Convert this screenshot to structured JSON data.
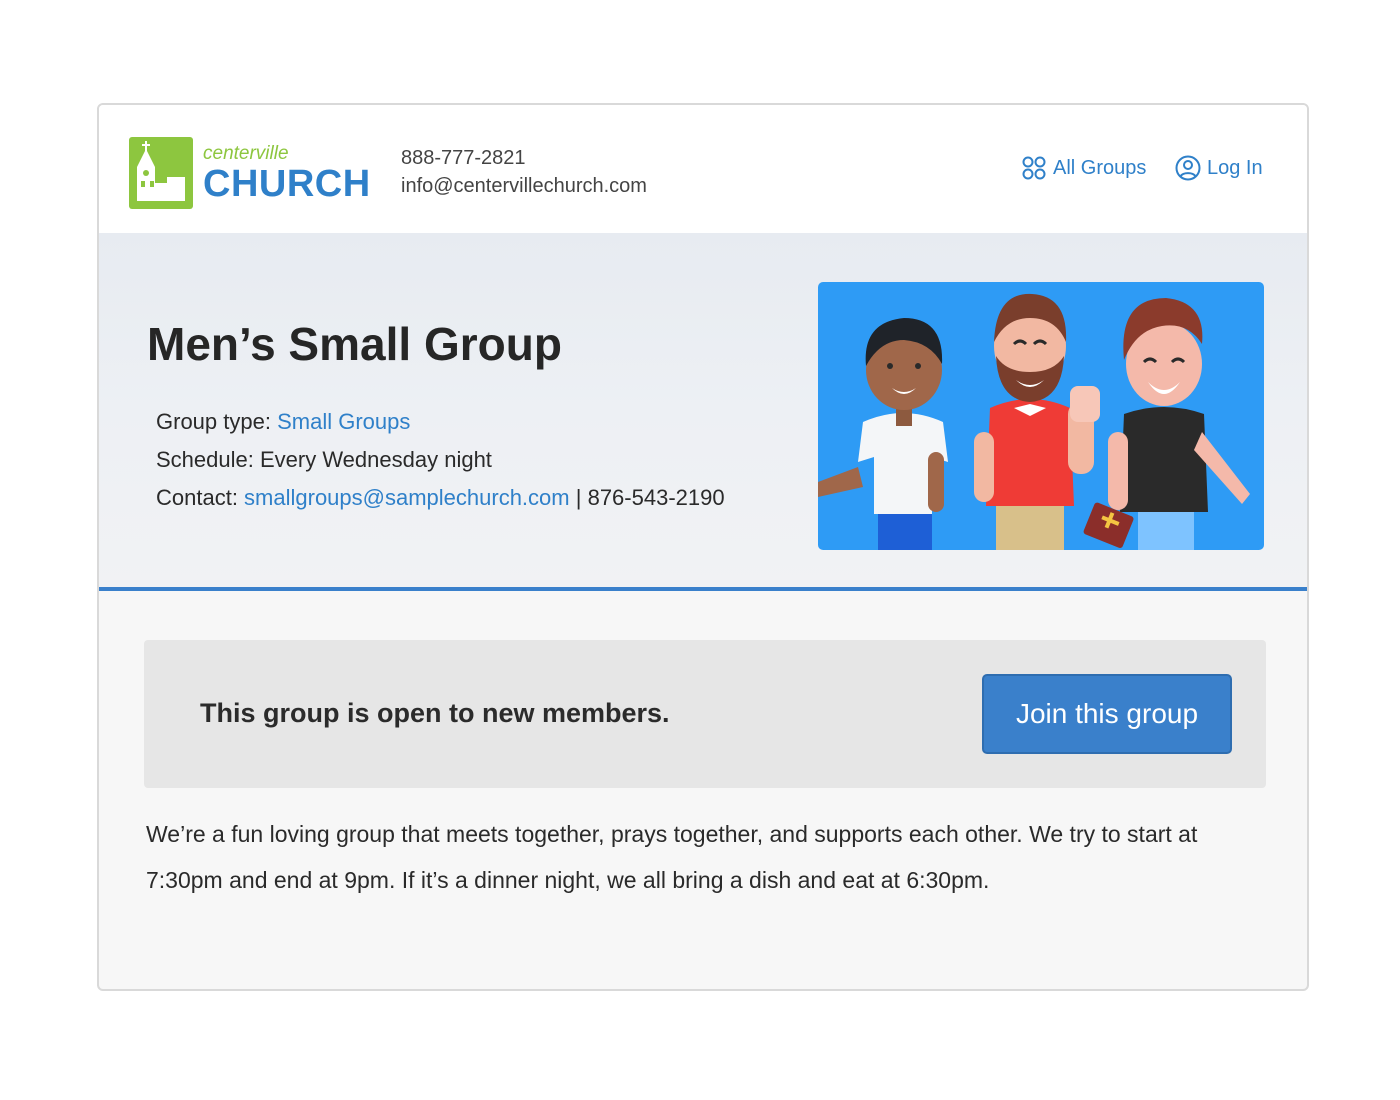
{
  "header": {
    "brand_small": "centerville",
    "brand_big": "CHURCH",
    "phone": "888-777-2821",
    "email": "info@centervillechurch.com",
    "nav": {
      "all_groups": "All Groups",
      "log_in": "Log In",
      "all_groups_icon": "groups-icon",
      "log_in_icon": "user-circle-icon"
    }
  },
  "hero": {
    "title": "Men’s Small Group",
    "group_type_label": "Group type: ",
    "group_type_value": "Small Groups",
    "schedule_label": "Schedule: ",
    "schedule_value": "Every Wednesday night",
    "contact_label": "Contact: ",
    "contact_email": "smallgroups@samplechurch.com",
    "contact_separator": " | ",
    "contact_phone": "876-543-2190"
  },
  "notice": {
    "text": "This group is open to new members.",
    "join_button": "Join this group"
  },
  "description": "We’re a fun loving group that meets together, prays together, and supports each other. We try to start at 7:30pm and end at 9pm. If it’s a dinner night, we all bring a dish and eat at 6:30pm.",
  "colors": {
    "brand_blue": "#2f80c9",
    "brand_green": "#8dc63f",
    "button_blue": "#3a80cb",
    "illustration_bg": "#2e9bf5"
  }
}
